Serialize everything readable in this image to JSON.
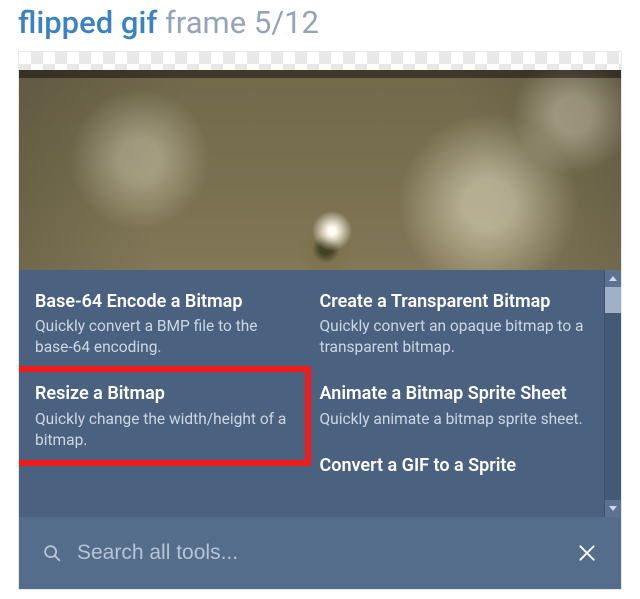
{
  "title": {
    "name": "flipped gif",
    "frame_prefix": "frame ",
    "frame_current": 5,
    "frame_total": 12
  },
  "tools": {
    "left": [
      {
        "title": "Base-64 Encode a Bitmap",
        "desc": "Quickly convert a BMP file to the base-64 encoding.",
        "highlighted": false
      },
      {
        "title": "Resize a Bitmap",
        "desc": "Quickly change the width/height of a bitmap.",
        "highlighted": true
      }
    ],
    "right": [
      {
        "title": "Create a Transparent Bitmap",
        "desc": "Quickly convert an opaque bitmap to a transparent bitmap."
      },
      {
        "title": "Animate a Bitmap Sprite Sheet",
        "desc": "Quickly animate a bitmap sprite sheet."
      }
    ],
    "right_partial": "Convert a GIF to a Sprite"
  },
  "search": {
    "placeholder": "Search all tools...",
    "value": ""
  }
}
